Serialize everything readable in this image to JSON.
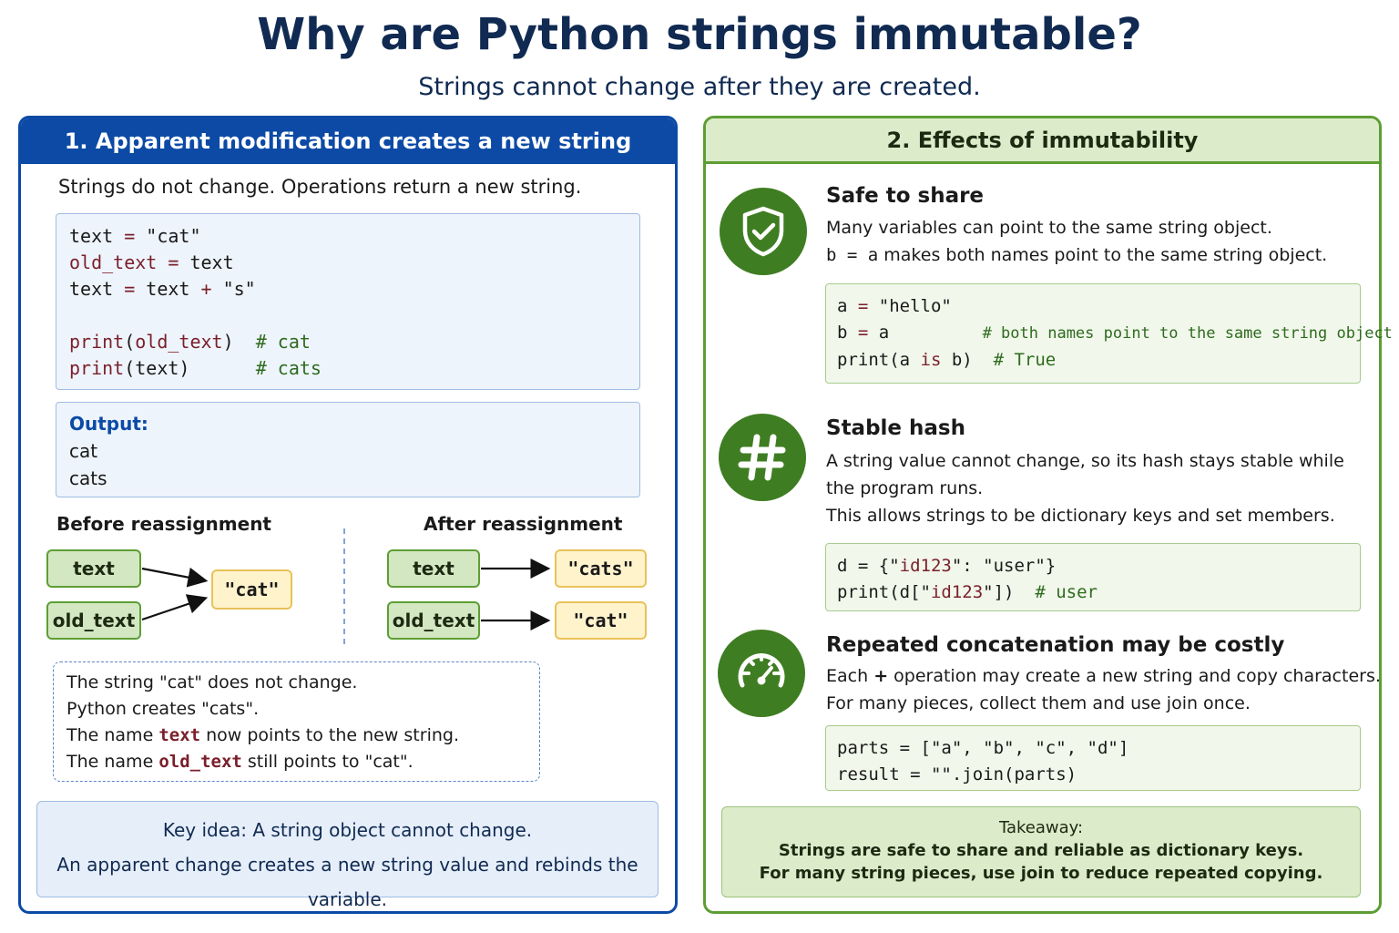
{
  "title": "Why are Python strings immutable?",
  "subtitle": "Strings cannot change after they are created.",
  "left": {
    "header": "1. Apparent modification creates a new string",
    "intro": "Strings do not change. Operations return a new string.",
    "code": {
      "l1a": "text",
      "l1b": " = ",
      "l1c": "\"cat\"",
      "l2a": "old_text",
      "l2b": " = ",
      "l2c": "text",
      "l3a": "text",
      "l3b": " = ",
      "l3c": "text",
      "l3d": " + ",
      "l3e": "\"s\"",
      "l5a": "print",
      "l5b": "(",
      "l5c": "old_text",
      "l5d": ")  ",
      "l5e": "# cat",
      "l6a": "print",
      "l6b": "(text)      ",
      "l6c": "# cats"
    },
    "output": {
      "label": "Output:",
      "line1": "cat",
      "line2": "cats"
    },
    "before_label": "Before reassignment",
    "after_label": "After reassignment",
    "before": {
      "name1": "text",
      "name2": "old_text",
      "value": "\"cat\""
    },
    "after": {
      "name1": "text",
      "name2": "old_text",
      "value1": "\"cats\"",
      "value2": "\"cat\""
    },
    "notes": {
      "n1": "The string \"cat\" does not change.",
      "n2": "Python creates \"cats\".",
      "n3a": "The name ",
      "n3b": "text",
      "n3c": " now points to the new string.",
      "n4a": "The name ",
      "n4b": "old_text",
      "n4c": " still points to \"cat\"."
    },
    "key1": "Key idea: A string object cannot change.",
    "key2": "An apparent change creates a new string value and rebinds the variable."
  },
  "right": {
    "header": "2. Effects of immutability",
    "s1": {
      "icon": "shield-check-icon",
      "title": "Safe to share",
      "t1": "Many variables can point to the same string object.",
      "t2a": "b",
      "t2b": " = ",
      "t2c": "a",
      "t2d": " makes both names point to the same string object.",
      "c1a": "a",
      "c1b": " = ",
      "c1c": "\"hello\"",
      "c2a": "b",
      "c2b": " = ",
      "c2c": "a",
      "c2d": "          # both names point to the same string object",
      "c3a": "print(a ",
      "c3b": "is",
      "c3c": " b)  ",
      "c3d": "# True"
    },
    "s2": {
      "icon": "hash-icon",
      "title": "Stable hash",
      "t1": "A string value cannot change, so its hash stays stable while",
      "t2": "the program runs.",
      "t3": "This allows strings to be dictionary keys and set members.",
      "c1a": "d",
      "c1b": " = {\"",
      "c1c": "id123",
      "c1d": "\": \"user\"}",
      "c2a": "print(d[\"",
      "c2b": "id123",
      "c2c": "\"])  ",
      "c2d": "# user"
    },
    "s3": {
      "icon": "speedometer-icon",
      "title": "Repeated concatenation may be costly",
      "t1a": "Each ",
      "t1b": "+",
      "t1c": " operation may create a new string and copy characters.",
      "t2": "For many pieces, collect them and use join once.",
      "c1": "parts = [\"a\", \"b\", \"c\", \"d\"]",
      "c2": "result = \"\".join(parts)"
    },
    "takeaway": {
      "t1": "Takeaway:",
      "t2": "Strings are safe to share and reliable as dictionary keys.",
      "t3": "For many string pieces, use join to reduce repeated copying."
    }
  },
  "colors": {
    "left_accent": "#0c4aa6",
    "right_accent": "#5d9e34",
    "icon_green": "#3f7d22",
    "keyword": "#7a1f2b",
    "comment": "#2e6b1f"
  }
}
